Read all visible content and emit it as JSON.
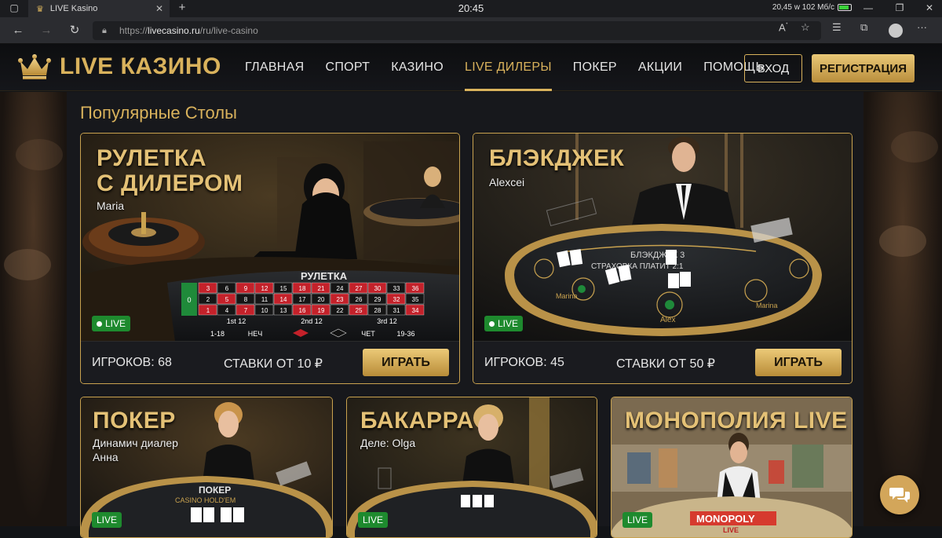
{
  "browser": {
    "tab_title": "LIVE Kasino",
    "clock": "20:45",
    "sysinfo": "20,45 w 102 Mб/c",
    "url_prefix": "https://",
    "url_host": "livecasino.ru",
    "url_path": "/ru/live-casino",
    "icons": [
      "back-icon",
      "forward-icon",
      "reload-icon",
      "lock-icon",
      "read-aloud-icon",
      "favorite-icon",
      "favorites-icon",
      "collections-icon",
      "profile-avatar",
      "more-icon"
    ]
  },
  "site": {
    "logo_text": "LIVE КАЗИНО",
    "nav": [
      {
        "label": "ГЛАВНАЯ",
        "active": false
      },
      {
        "label": "СПОРТ",
        "active": false
      },
      {
        "label": "КАЗИНО",
        "active": false
      },
      {
        "label": "LIVE ДИЛЕРЫ",
        "active": true
      },
      {
        "label": "ПОКЕР",
        "active": false
      },
      {
        "label": "АКЦИИ",
        "active": false
      },
      {
        "label": "ПОМОЩЬ",
        "active": false
      }
    ],
    "login_label": "ВХОД",
    "register_label": "РЕГИСТРАЦИЯ",
    "accent_color": "#d9b25c"
  },
  "section": {
    "title": "Популярные Столы"
  },
  "cards": [
    {
      "title": "РУЛЕТКА С ДИЛЕРОМ",
      "title_line1": "РУЛЕТКА",
      "title_line2": "С ДИЛЕРОМ",
      "dealer": "Maria",
      "badge": "LIVE",
      "players": "ИГРОКОВ: 68",
      "bets": "СТАВКИ ОТ 10 ₽",
      "play": "ИГРАТЬ",
      "table_text": "РУЛЕТКА"
    },
    {
      "title": "БЛЭКДЖЕК",
      "dealer": "Alexcei",
      "badge": "LIVE",
      "players": "ИГРОКОВ: 45",
      "bets": "СТАВКИ ОТ 50 ₽",
      "play": "ИГРАТЬ",
      "table_text": "БЛЭКДЖЕК 3",
      "table_text2": "СТРАХОВКА ПЛАТИТ 2:1",
      "seat_labels": [
        "Marina",
        "Alex",
        "Marina"
      ]
    },
    {
      "title": "ПОКЕР",
      "dealer_line1": "Динамич диалер",
      "dealer_line2": "Анна",
      "badge": "LIVE",
      "table_text": "ПОКЕР",
      "table_text2": "CASINO HOLD'EM"
    },
    {
      "title": "БАКАРРА",
      "dealer": "Деле: Olga",
      "badge": "LIVE"
    },
    {
      "title": "МОНОПОЛИЯ LIVE",
      "badge": "LIVE",
      "table_text": "MONOPOLY",
      "table_text2": "LIVE"
    }
  ],
  "roulette_numbers": [
    [
      "3",
      "6",
      "9",
      "12",
      "15",
      "18",
      "21",
      "24",
      "27",
      "30",
      "33",
      "36"
    ],
    [
      "2",
      "5",
      "8",
      "11",
      "14",
      "17",
      "20",
      "23",
      "26",
      "29",
      "32",
      "35"
    ],
    [
      "1",
      "4",
      "7",
      "10",
      "13",
      "16",
      "19",
      "22",
      "25",
      "28",
      "31",
      "34"
    ]
  ],
  "roulette_bets": [
    "1st 12",
    "2nd 12",
    "3rd 12",
    "1-18",
    "НЕЧ",
    "ЧЕТ",
    "19-36",
    "0"
  ],
  "chat_icon": "chat-icon"
}
